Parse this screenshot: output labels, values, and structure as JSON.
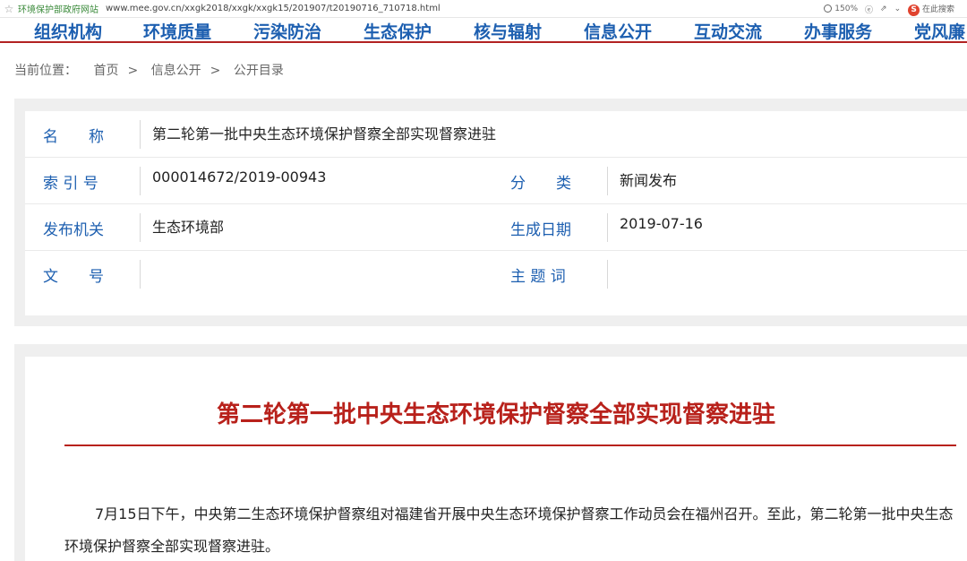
{
  "browser": {
    "site_name": "环境保护部政府网站",
    "url": "www.mee.gov.cn/xxgk2018/xxgk/xxgk15/201907/t20190716_710718.html",
    "zoom": "150%",
    "search_placeholder": "在此搜索"
  },
  "nav": {
    "items": [
      "组织机构",
      "环境质量",
      "污染防治",
      "生态保护",
      "核与辐射",
      "信息公开",
      "互动交流",
      "办事服务",
      "党风廉"
    ]
  },
  "breadcrumb": {
    "prefix": "当前位置：",
    "items": [
      "首页",
      "信息公开",
      "公开目录"
    ],
    "separator": ">"
  },
  "info": {
    "name_label": "名　　称",
    "name_value": "第二轮第一批中央生态环境保护督察全部实现督察进驻",
    "index_label": "索 引 号",
    "index_value": "000014672/2019-00943",
    "category_label": "分　　类",
    "category_value": "新闻发布",
    "issuer_label": "发布机关",
    "issuer_value": "生态环境部",
    "date_label": "生成日期",
    "date_value": "2019-07-16",
    "doc_label": "文　　号",
    "doc_value": "",
    "subject_label": "主 题 词",
    "subject_value": ""
  },
  "article": {
    "title": "第二轮第一批中央生态环境保护督察全部实现督察进驻",
    "paragraph": "7月15日下午，中央第二生态环境保护督察组对福建省开展中央生态环境保护督察工作动员会在福州召开。至此，第二轮第一批中央生态环境保护督察全部实现督察进驻。"
  },
  "colors": {
    "nav_text": "#1d5fb0",
    "nav_rule": "#b22222",
    "label_blue": "#1d5fb0",
    "title_red": "#b8211b"
  }
}
